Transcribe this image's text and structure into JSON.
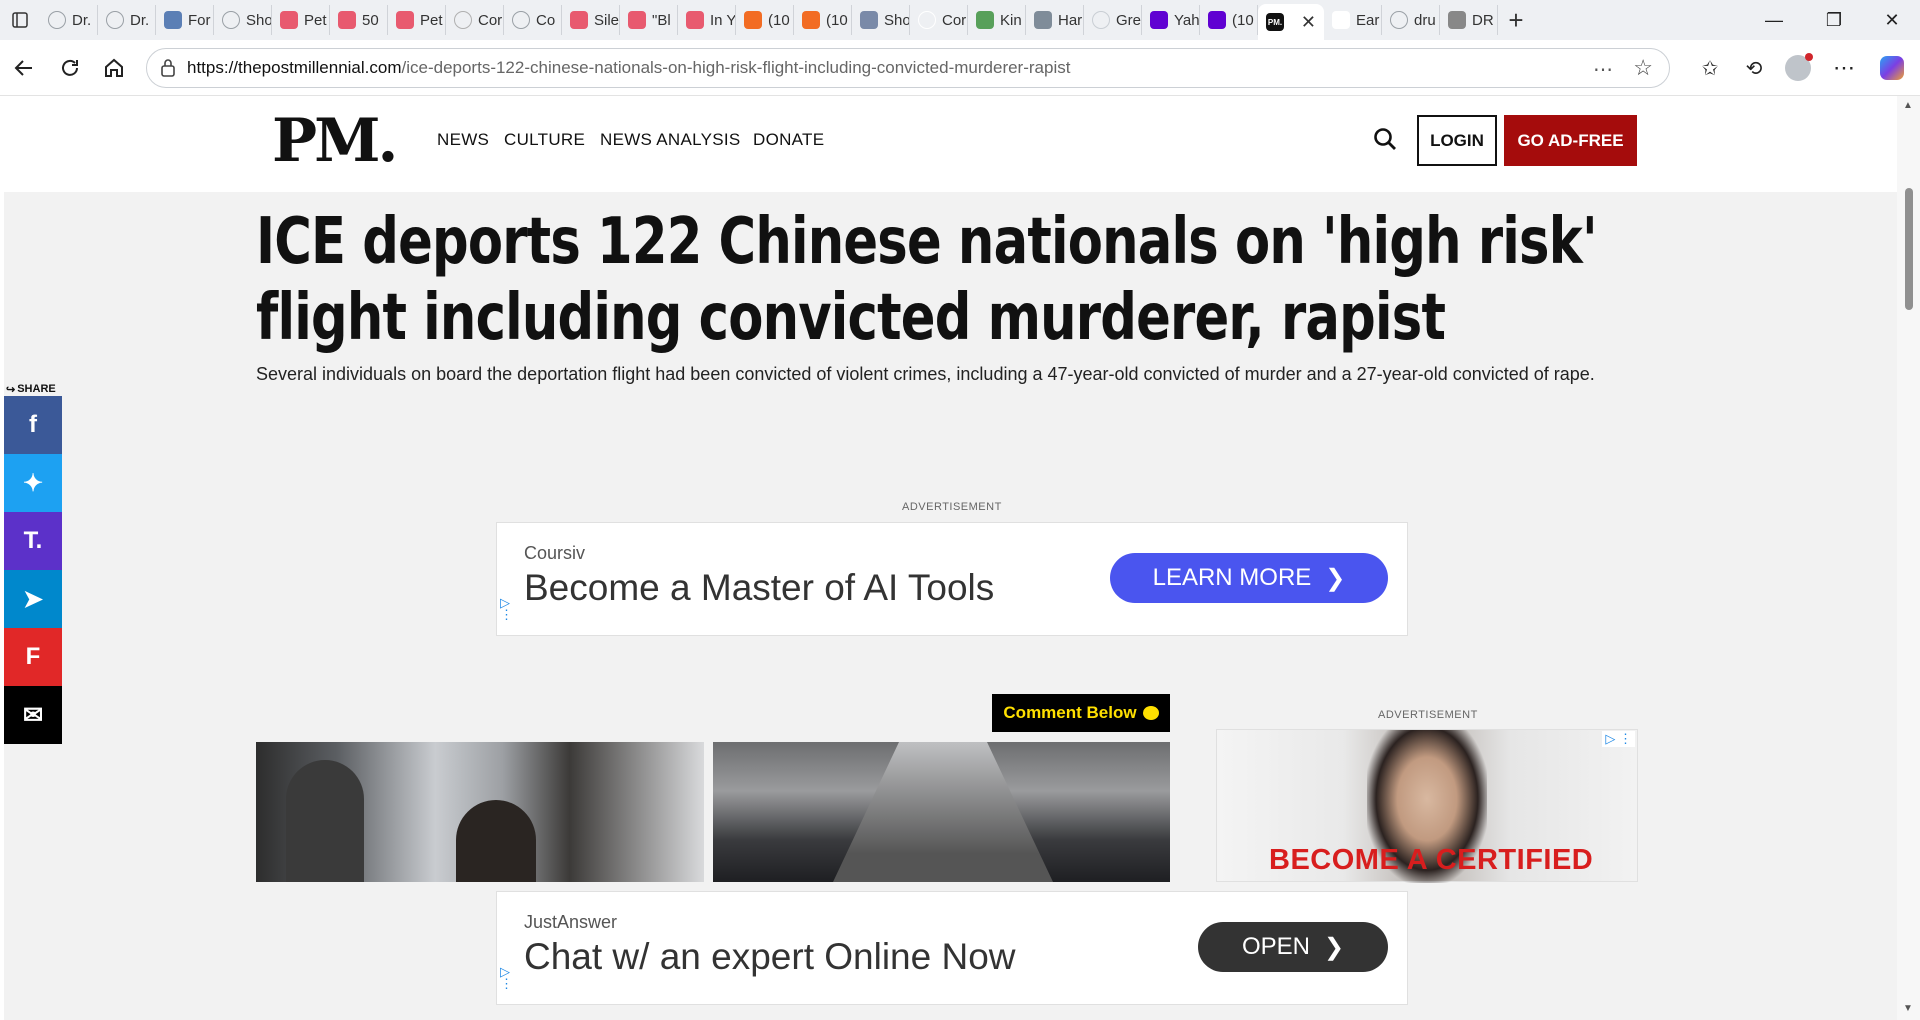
{
  "browser": {
    "tabs": [
      {
        "label": "Dr.",
        "fav": "globe",
        "color": "#9aa0a6"
      },
      {
        "label": "Dr.",
        "fav": "globe",
        "color": "#9aa0a6"
      },
      {
        "label": "For",
        "fav": "news",
        "color": "#5b7fb5"
      },
      {
        "label": "Sho",
        "fav": "globe",
        "color": "#9aa0a6"
      },
      {
        "label": "Pet",
        "fav": "youtube",
        "color": "#e85a6f"
      },
      {
        "label": "50",
        "fav": "youtube",
        "color": "#e85a6f"
      },
      {
        "label": "Pet",
        "fav": "youtube",
        "color": "#e85a6f"
      },
      {
        "label": "Cor",
        "fav": "seal",
        "color": "#b0b0b0"
      },
      {
        "label": "Co",
        "fav": "globe",
        "color": "#9aa0a6"
      },
      {
        "label": "Sile",
        "fav": "youtube",
        "color": "#e85a6f"
      },
      {
        "label": "\"Bl",
        "fav": "youtube",
        "color": "#e85a6f"
      },
      {
        "label": "In Y",
        "fav": "youtube",
        "color": "#e85a6f"
      },
      {
        "label": "(10",
        "fav": "substack",
        "color": "#f26c23"
      },
      {
        "label": "(10",
        "fav": "substack",
        "color": "#f26c23"
      },
      {
        "label": "Sho",
        "fav": "m-letter",
        "color": "#7a8aa8"
      },
      {
        "label": "Cor",
        "fav": "blank",
        "color": "#ffffff"
      },
      {
        "label": "Kin",
        "fav": "green",
        "color": "#58a05a"
      },
      {
        "label": "Har",
        "fav": "shield",
        "color": "#7f8c99"
      },
      {
        "label": "Gre",
        "fav": "g-letter",
        "color": "#c9ced4"
      },
      {
        "label": "Yah",
        "fav": "yahoo",
        "color": "#6001d2"
      },
      {
        "label": "(10",
        "fav": "mail",
        "color": "#6001d2"
      }
    ],
    "active_tab": {
      "label": "PM.",
      "fav": "pm",
      "color": "#111111"
    },
    "tabs_after": [
      {
        "label": "Ear",
        "fav": "fp",
        "color": "#ffffff"
      },
      {
        "label": "dru",
        "fav": "search",
        "color": "#9aa0a6"
      },
      {
        "label": "DR",
        "fav": "dr",
        "color": "#888888"
      }
    ],
    "url_domain": "https://thepostmillennial.com",
    "url_path": "/ice-deports-122-chinese-nationals-on-high-risk-flight-including-convicted-murderer-rapist"
  },
  "site": {
    "logo": "PM.",
    "nav": [
      "NEWS",
      "CULTURE",
      "NEWS ANALYSIS",
      "DONATE"
    ],
    "login_label": "LOGIN",
    "adfree_label": "GO AD-FREE"
  },
  "article": {
    "headline": "ICE deports 122 Chinese nationals on 'high risk' flight including convicted murderer, rapist",
    "dek": "Several individuals on board the deportation flight had been convicted of violent crimes, including a 47-year-old convicted of murder and a 27-year-old convicted of rape.",
    "comment_label": "Comment Below",
    "share_label": "SHARE"
  },
  "ads": {
    "label": "ADVERTISEMENT",
    "top": {
      "brand": "Coursiv",
      "title": "Become a Master of AI Tools",
      "cta": "LEARN MORE",
      "cta_color": "#4a55ef"
    },
    "side": {
      "overlay_text": "BECOME A CERTIFIED"
    },
    "bottom": {
      "brand": "JustAnswer",
      "title": "Chat w/ an expert Online Now",
      "cta": "OPEN",
      "cta_color": "#333333"
    }
  },
  "share_buttons": [
    {
      "name": "facebook",
      "glyph": "f",
      "color": "#3b5998"
    },
    {
      "name": "twitter",
      "glyph": "✦",
      "color": "#1da1f2"
    },
    {
      "name": "truth-social",
      "glyph": "T.",
      "color": "#5c31c9"
    },
    {
      "name": "telegram",
      "glyph": "➤",
      "color": "#0088cc"
    },
    {
      "name": "flipboard",
      "glyph": "F",
      "color": "#e12828"
    },
    {
      "name": "email",
      "glyph": "✉",
      "color": "#000000"
    }
  ]
}
